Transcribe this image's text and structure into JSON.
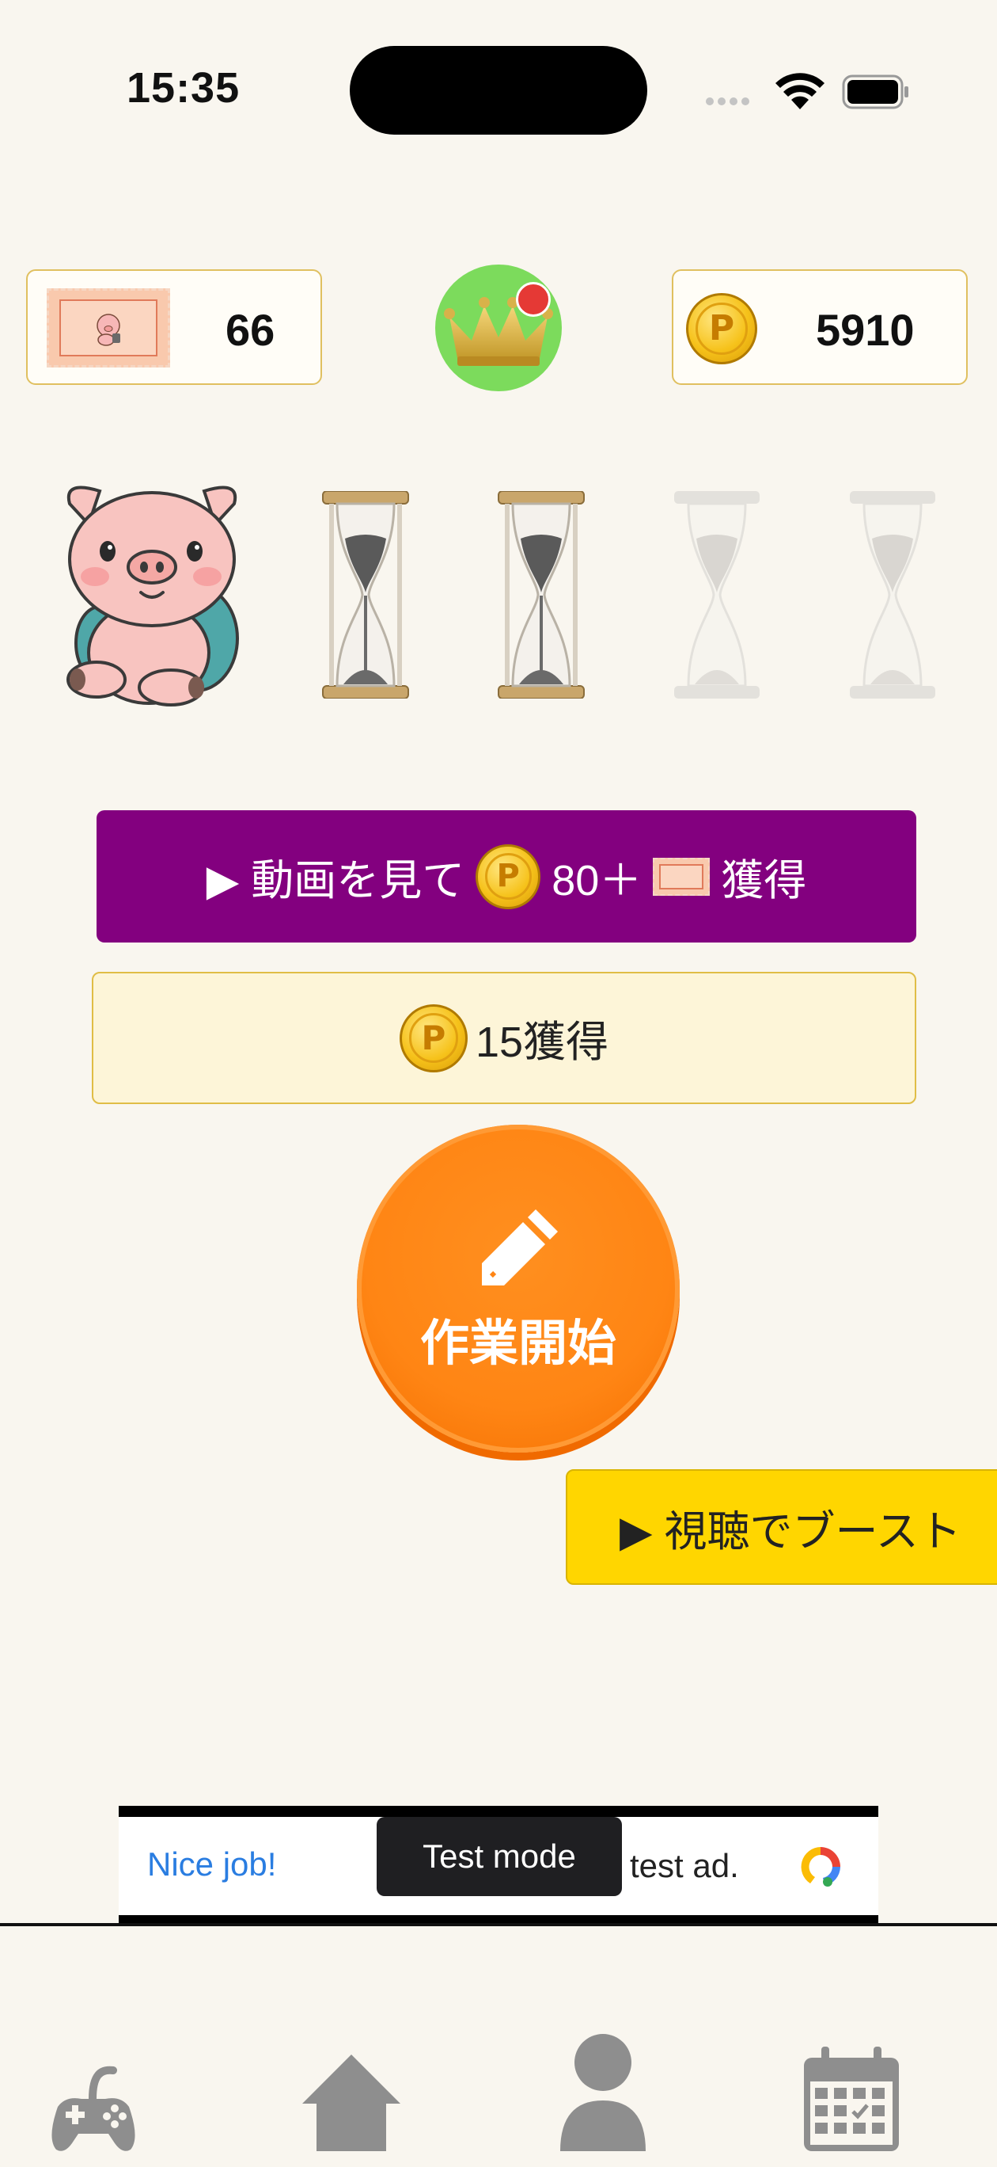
{
  "status_bar": {
    "time": "15:35"
  },
  "counters": {
    "tickets": "66",
    "coins": "5910"
  },
  "crown": {
    "has_notification": true
  },
  "hourglasses": {
    "total": 4,
    "filled": 2
  },
  "actions": {
    "video_reward_prefix": "▶ 動画を見て",
    "video_reward_amount": "80＋",
    "video_reward_suffix": "獲得",
    "coin_reward_label": "15獲得",
    "start_label": "作業開始",
    "boost_label": "▶ 視聴でブースト"
  },
  "ad": {
    "headline": "Nice job!",
    "body": "test ad.",
    "toast": "Test mode"
  },
  "tabs": [
    {
      "icon": "game-controller-icon"
    },
    {
      "icon": "home-icon"
    },
    {
      "icon": "person-icon"
    },
    {
      "icon": "calendar-icon"
    }
  ],
  "colors": {
    "background": "#f9f6ef",
    "video_button": "#83007f",
    "start_button": "#ff8514",
    "boost_button": "#ffd600",
    "crown_bg": "#7cdb5c",
    "tab_icon": "#8e8e8e"
  }
}
